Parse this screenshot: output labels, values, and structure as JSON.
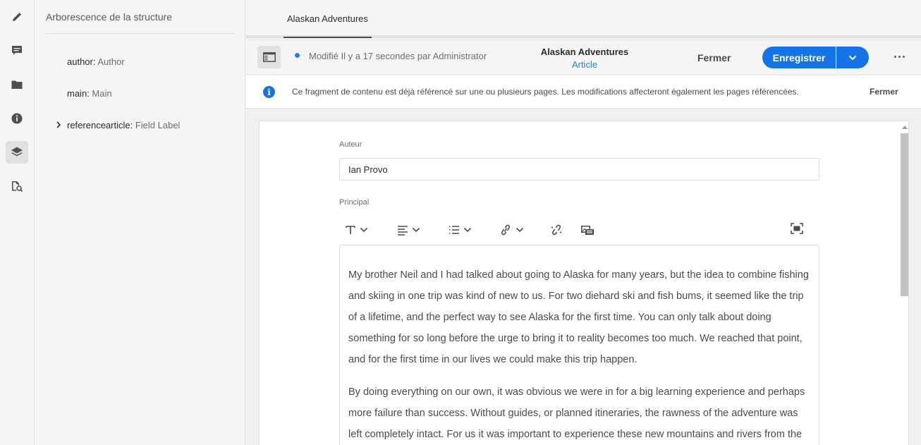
{
  "rail": {
    "items": [
      {
        "icon": "edit-pencil-icon"
      },
      {
        "icon": "comment-icon"
      },
      {
        "icon": "folder-icon"
      },
      {
        "icon": "info-icon"
      },
      {
        "icon": "layers-icon",
        "active": true
      },
      {
        "icon": "references-search-icon"
      }
    ]
  },
  "tree": {
    "title": "Arborescence de la structure",
    "items": [
      {
        "key": "author:",
        "label": "Author"
      },
      {
        "key": "main:",
        "label": "Main"
      },
      {
        "key": "referencearticle:",
        "label": "Field Label",
        "expandable": true
      }
    ]
  },
  "tabs": [
    {
      "label": "Alaskan Adventures",
      "active": true
    }
  ],
  "toolbar": {
    "status": "Modifié Il y a 17 secondes par Administrator",
    "title": "Alaskan Adventures",
    "model": "Article",
    "close_label": "Fermer",
    "save_label": "Enregistrer"
  },
  "infobar": {
    "message": "Ce fragment de contenu est déjà référencé sur une ou plusieurs pages. Les modifications affecteront également les pages référencées.",
    "close_label": "Fermer"
  },
  "editor": {
    "author_label": "Auteur",
    "author_value": "Ian Provo",
    "main_label": "Principal",
    "paragraphs": [
      "My brother Neil and I had talked about going to Alaska for many years, but the idea to combine fishing and skiing in one trip was kind of new to us. For two diehard ski and fish bums, it seemed like the trip of a lifetime, and the perfect way to see Alaska for the first time. You can only talk about doing something for so long before the urge to bring it to reality becomes too much. We reached that point, and for the first time in our lives we could make this trip happen.",
      "By doing everything on our own, it was obvious we were in for a big learning experience and perhaps more failure than success. Without guides, or planned itineraries, the rawness of the adventure was left completely intact. For us it was important to experience these new mountains and rivers from the ground"
    ]
  },
  "colors": {
    "accent": "#1473e6",
    "status_dot": "#2680eb"
  }
}
